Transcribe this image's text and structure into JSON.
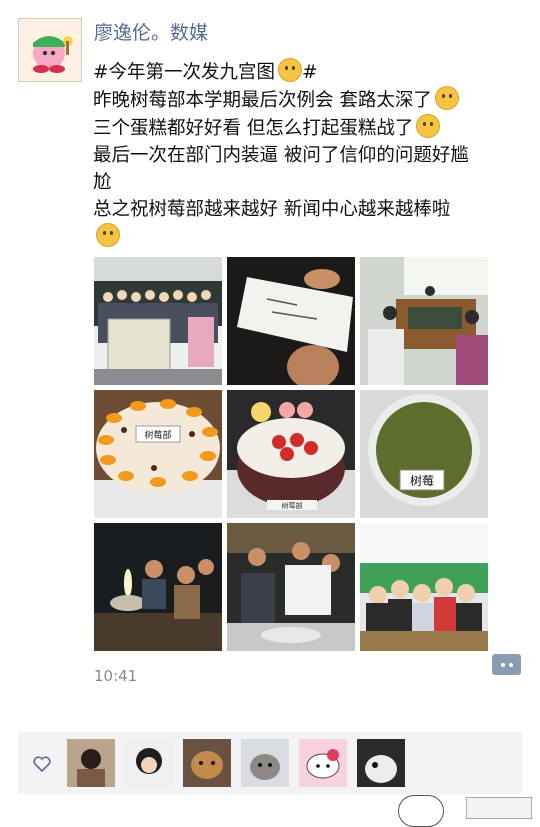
{
  "post": {
    "username": "廖逸伦。数媒",
    "lines": [
      "#今年第一次发九宫图",
      "昨晚树莓部本学期最后次例会 套路太深了",
      "三个蛋糕都好好看 但怎么打起蛋糕战了",
      "最后一次在部门内装逼 被问了信仰的问题好尴",
      "尬",
      "总之祝树莓部越来越好 新闻中心越来越棒啦"
    ],
    "line1_suffix": "#",
    "timestamp": "10:41"
  },
  "photos": [
    {
      "label": "group-photo"
    },
    {
      "label": "hand-writing-card"
    },
    {
      "label": "meeting-room"
    },
    {
      "label": "fruit-cake",
      "caption": "树莓部"
    },
    {
      "label": "strawberry-cake",
      "caption": "树莓部"
    },
    {
      "label": "green-cake",
      "caption": "树莓"
    },
    {
      "label": "candle-party"
    },
    {
      "label": "cake-fight"
    },
    {
      "label": "group-selfie"
    }
  ],
  "icons": {
    "emoji": "grinning-emoji",
    "comment": "comment-dots-icon",
    "like": "heart-icon"
  },
  "colors": {
    "username": "#576b95",
    "comment_button": "#8a9bb5",
    "likes_bg": "#f3f3f5"
  }
}
